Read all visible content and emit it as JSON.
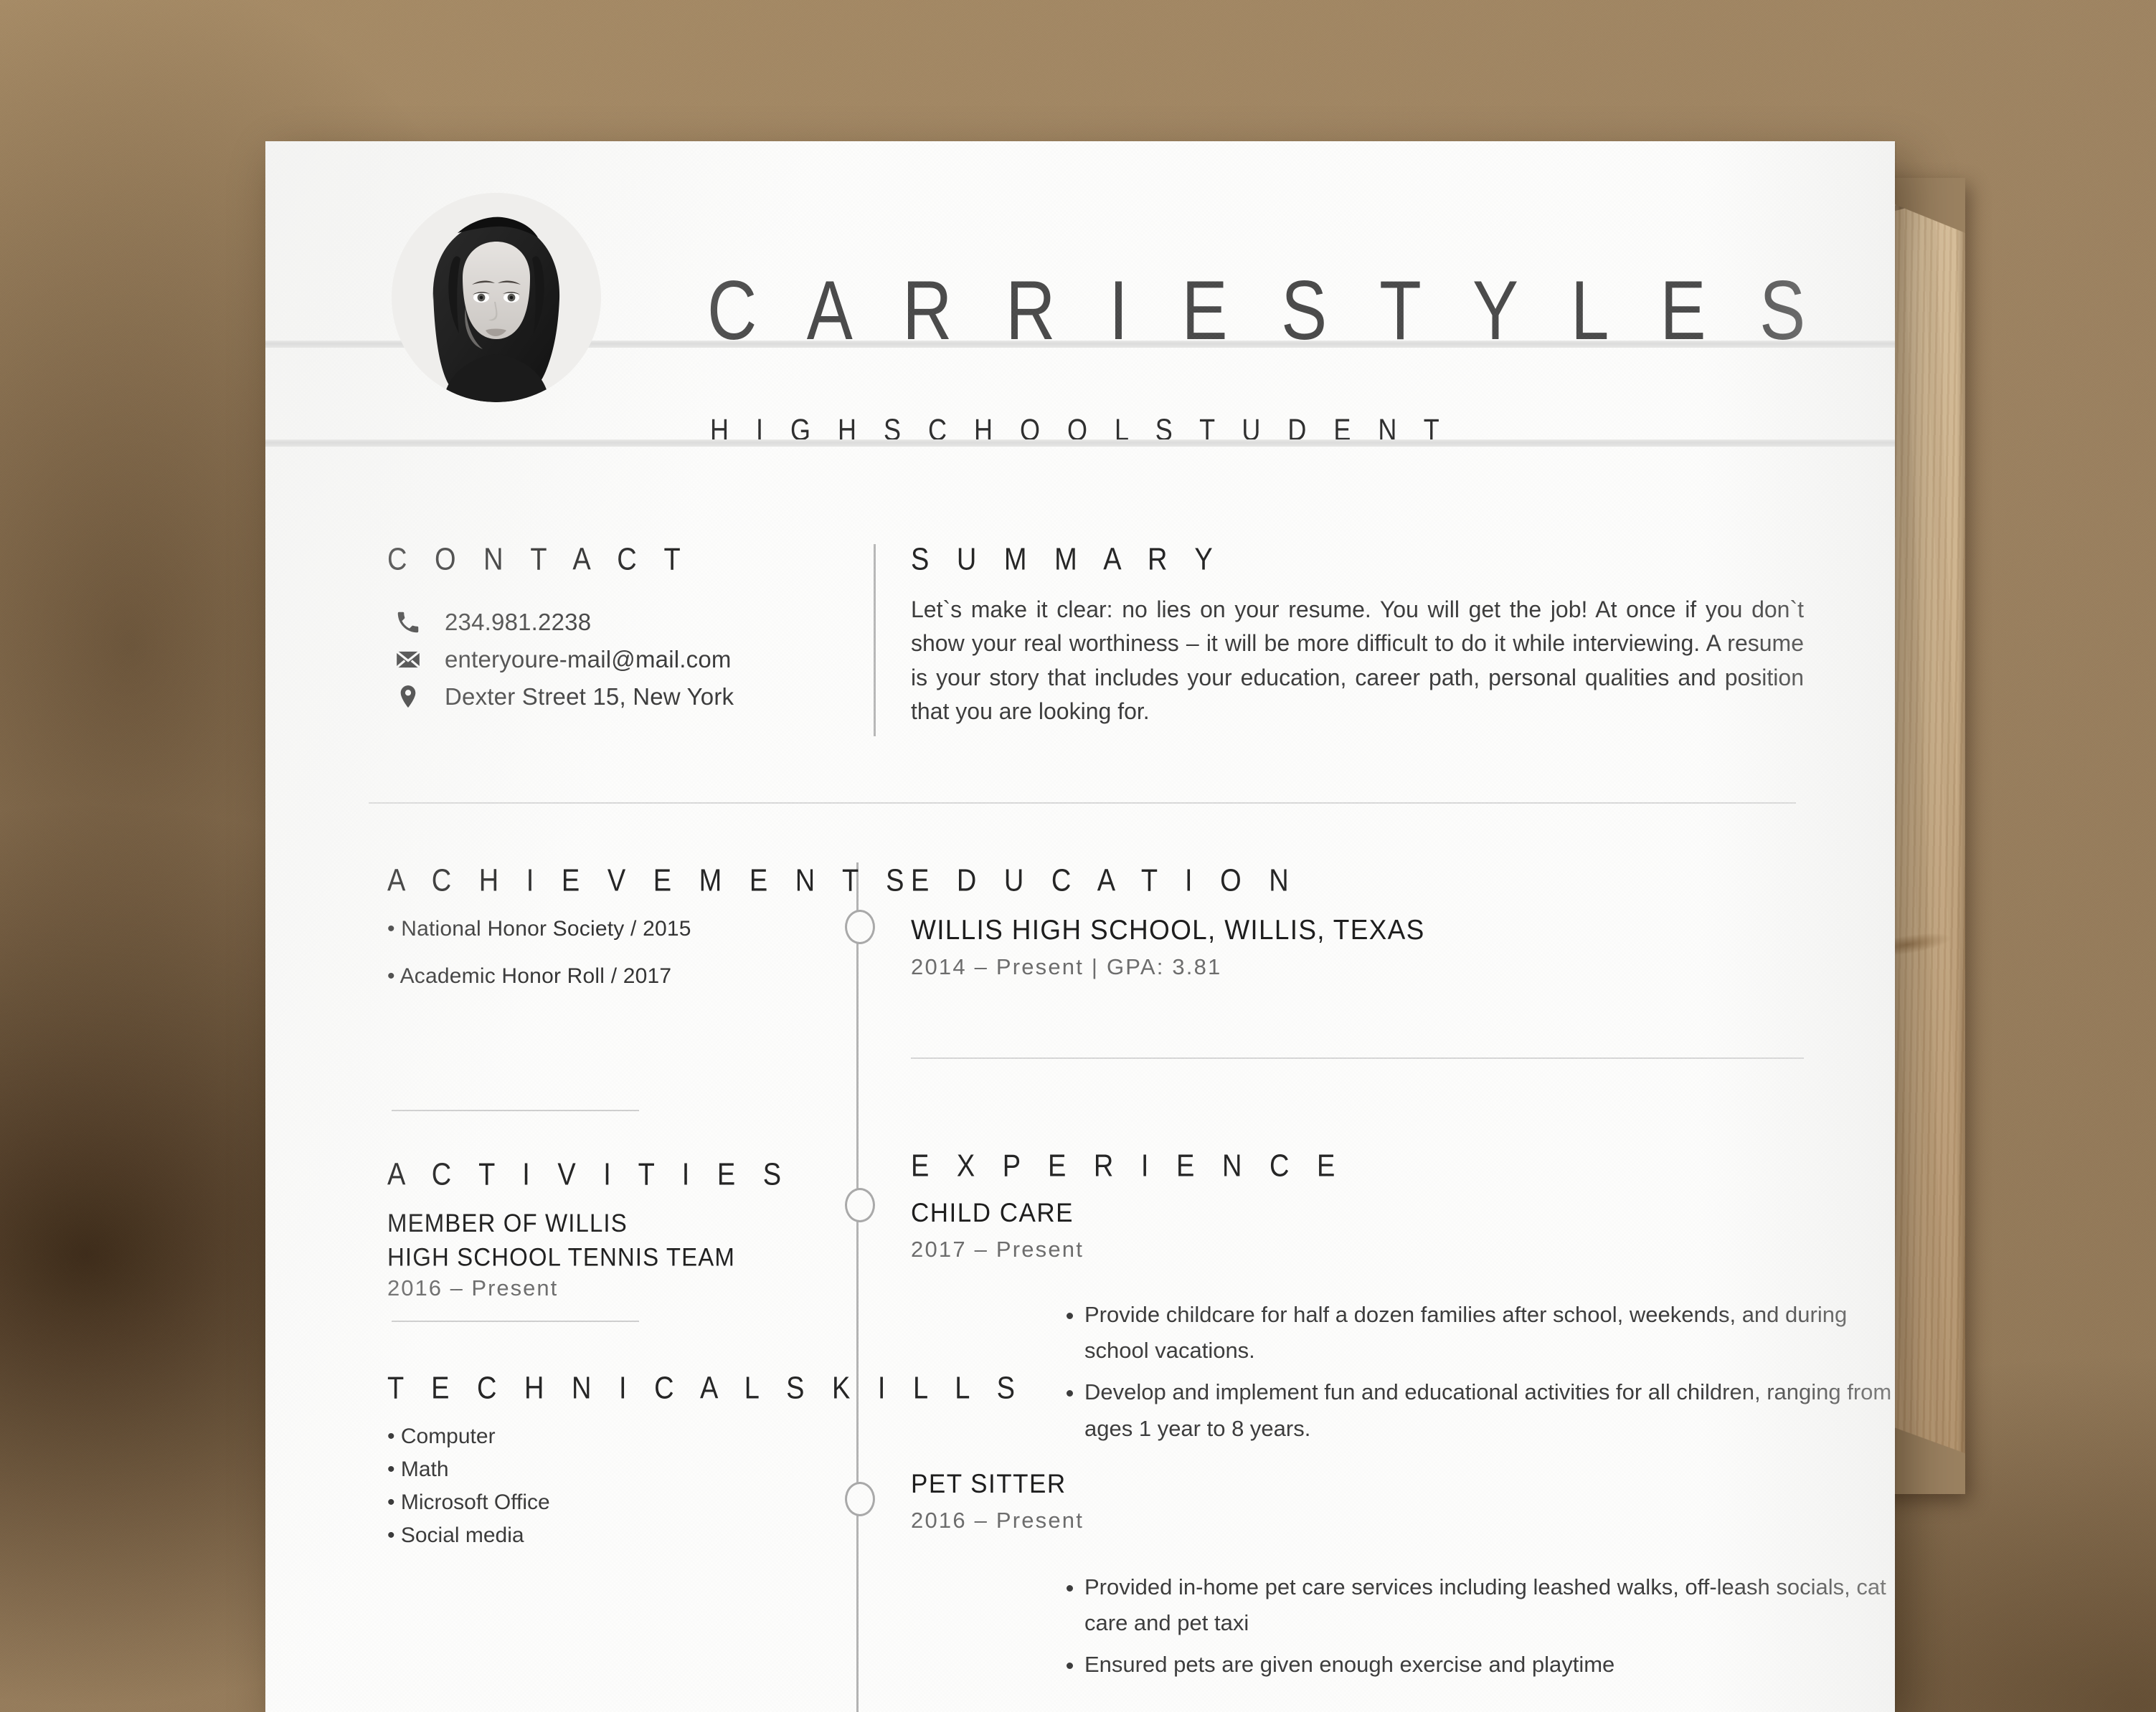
{
  "header": {
    "name": "C A R R I E   S T Y L E S",
    "role": "H I G H   S C H O O L   S T U D E N T",
    "avatar_alt": "portrait-photo"
  },
  "contact": {
    "title": "C O N T A C T",
    "items": [
      {
        "icon": "phone-icon",
        "value": "234.981.2238"
      },
      {
        "icon": "envelope-icon",
        "value": "enteryoure-mail@mail.com"
      },
      {
        "icon": "location-pin-icon",
        "value": "Dexter Street 15, New York"
      }
    ]
  },
  "summary": {
    "title": "S U M M A R Y",
    "body": "Let`s make it clear: no lies on your resume. You will get the job! At once if you don`t show your real worthiness – it will be more difficult to do it while interviewing. A resume is your story that includes your education, career path, personal qualities and position that you are looking for."
  },
  "achievements": {
    "title": "A C H I E V E M E N T S",
    "items": [
      "• National Honor Society / 2015",
      "• Academic Honor Roll / 2017"
    ]
  },
  "activities": {
    "title": "A C T I V I T I E S",
    "name": "MEMBER OF WILLIS\nHIGH SCHOOL TENNIS TEAM",
    "date": "2016 – Present"
  },
  "skills": {
    "title": "T E C H N I C A L   S K I L L S",
    "items": [
      "• Computer",
      "• Math",
      "• Microsoft Office",
      "• Social media"
    ]
  },
  "education": {
    "title": "E D U C A T I O N",
    "school": "WILLIS HIGH SCHOOL, WILLIS, TEXAS",
    "date": "2014 – Present | GPA: 3.81"
  },
  "experience": {
    "title": "E X P E R I E N C E",
    "jobs": [
      {
        "title": "CHILD CARE",
        "date": "2017 – Present",
        "bullets": [
          "Provide childcare for half a dozen families after school, weekends, and during school vacations.",
          "Develop and implement fun and educational activities for all children, ranging from ages 1 year to 8 years."
        ]
      },
      {
        "title": "PET SITTER",
        "date": "2016 – Present",
        "bullets": [
          "Provided in-home pet care services including leashed walks, off-leash socials, cat care and pet taxi",
          "Ensured pets are given enough exercise and playtime"
        ]
      }
    ]
  },
  "colors": {
    "backdrop": "#9a8160",
    "page": "#fdfdfc",
    "rule": "#dcdcdb",
    "text_dark": "#1c1c1c",
    "text_body": "#3c3c3c",
    "text_muted": "#6c6c6c",
    "timeline": "#b4b4b4",
    "wood": "#cdb28c"
  }
}
